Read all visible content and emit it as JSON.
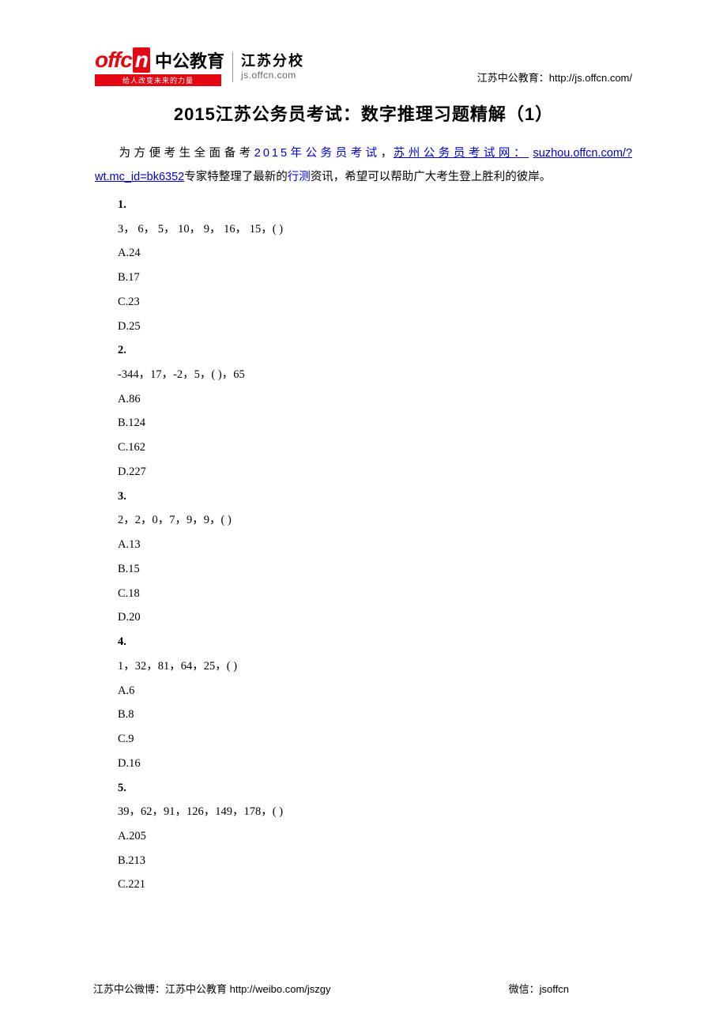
{
  "logo": {
    "brand_en_prefix": "offc",
    "brand_en_box": "n",
    "brand_cn": "中公教育",
    "tagline": "给人改变未来的力量",
    "branch_name": "江苏分校",
    "branch_url": "js.offcn.com"
  },
  "header_right": "江苏中公教育：http://js.offcn.com/",
  "title": "2015江苏公务员考试：数字推理习题精解（1）",
  "intro": {
    "t1": "为方便考生全面备考",
    "link1": "2015年公务员考试",
    "t2": "，",
    "link2a": "苏州公务员考试网：",
    "link2b": "suzhou.offcn.com/?wt.mc_id=bk6352",
    "t3": "专家特整理了最新的",
    "link3": "行测",
    "t4": "资讯，希望可以帮助广大考生登上胜利的彼岸。"
  },
  "questions": [
    {
      "num": "1.",
      "seq": "3， 6， 5， 10， 9， 16， 15，( )",
      "opts": [
        "A.24",
        "B.17",
        "C.23",
        "D.25"
      ]
    },
    {
      "num": "2.",
      "seq": "-344，17，-2，5，( )，65",
      "opts": [
        "A.86",
        "B.124",
        "C.162",
        "D.227"
      ]
    },
    {
      "num": "3.",
      "seq": "2，2，0，7，9，9，( )",
      "opts": [
        "A.13",
        "B.15",
        "C.18",
        "D.20"
      ]
    },
    {
      "num": "4.",
      "seq": "1，32，81，64，25，( )",
      "opts": [
        "A.6",
        "B.8",
        "C.9",
        "D.16"
      ]
    },
    {
      "num": "5.",
      "seq": "39，62，91，126，149，178，( )",
      "opts": [
        "A.205",
        "B.213",
        "C.221"
      ]
    }
  ],
  "footer": {
    "left": "江苏中公微博：江苏中公教育   http://weibo.com/jszgy",
    "right": "微信：jsoffcn"
  }
}
